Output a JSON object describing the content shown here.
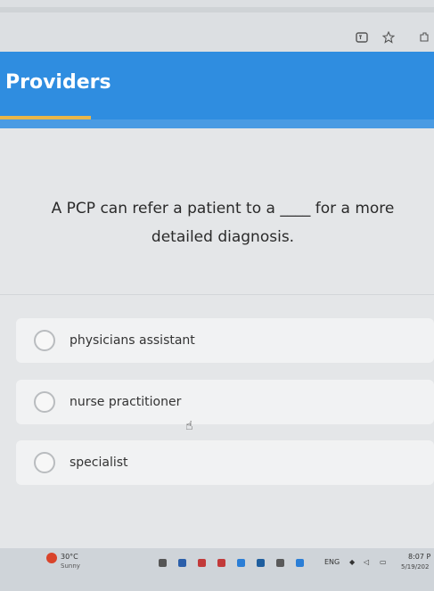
{
  "browser": {
    "icons": [
      "translate-icon",
      "star-icon",
      "extensions-icon"
    ]
  },
  "header": {
    "title": "Providers"
  },
  "question": {
    "text": "A PCP can refer a patient to a ____ for a more detailed diagnosis."
  },
  "options": [
    {
      "label": "physicians assistant"
    },
    {
      "label": "nurse practitioner"
    },
    {
      "label": "specialist"
    }
  ],
  "taskbar": {
    "weather_temp": "30°C",
    "weather_desc": "Sunny",
    "lang": "ENG",
    "time": "8:07 P",
    "date": "5/19/202"
  },
  "colors": {
    "header": "#2f8de0",
    "accent": "#e8b64a",
    "option_bg": "#f1f2f3"
  }
}
